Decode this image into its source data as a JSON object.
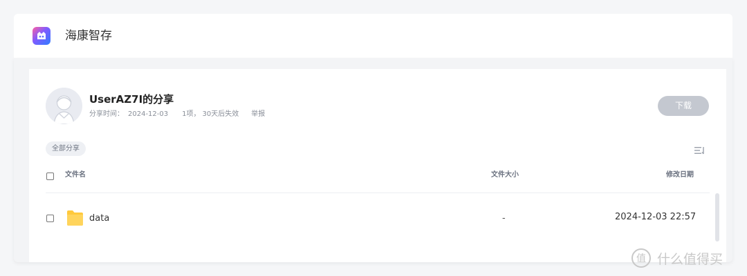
{
  "app": {
    "title": "海康智存"
  },
  "share": {
    "title": "UserAZ7I的分享",
    "time_label": "分享时间：",
    "date": "2024-12-03",
    "items": "1项，",
    "expiry": "30天后失效",
    "report": "举报"
  },
  "toolbar": {
    "download_label": "下载"
  },
  "breadcrumb": {
    "label": "全部分享"
  },
  "table": {
    "columns": {
      "name": "文件名",
      "size": "文件大小",
      "modified": "修改日期"
    },
    "rows": [
      {
        "name": "data",
        "size": "-",
        "modified": "2024-12-03 22:57",
        "icon": "folder-icon"
      }
    ]
  },
  "watermark": {
    "text": "什么值得买"
  },
  "colors": {
    "download_button": "#c4c8d0",
    "folder": "#ffc93c",
    "logo_gradient": [
      "#ff5fa3",
      "#7d5cff",
      "#2f7cff"
    ]
  }
}
